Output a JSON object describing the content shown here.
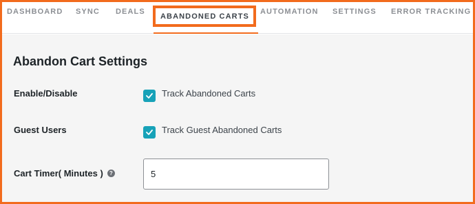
{
  "tabs": [
    {
      "label": "DASHBOARD"
    },
    {
      "label": "SYNC"
    },
    {
      "label": "DEALS"
    },
    {
      "label": "ABANDONED CARTS",
      "active": true
    },
    {
      "label": "AUTOMATION"
    },
    {
      "label": "SETTINGS"
    },
    {
      "label": "ERROR TRACKING"
    }
  ],
  "panel": {
    "title": "Abandon Cart Settings",
    "enable": {
      "label": "Enable/Disable",
      "checkbox_label": "Track Abandoned Carts",
      "checked": true
    },
    "guest": {
      "label": "Guest Users",
      "checkbox_label": "Track Guest Abandoned Carts",
      "checked": true
    },
    "timer": {
      "label": "Cart Timer( Minutes )",
      "help_icon": "question-icon",
      "value": "5"
    }
  },
  "colors": {
    "highlight": "#f26b1d",
    "checkbox": "#17a2b8"
  }
}
